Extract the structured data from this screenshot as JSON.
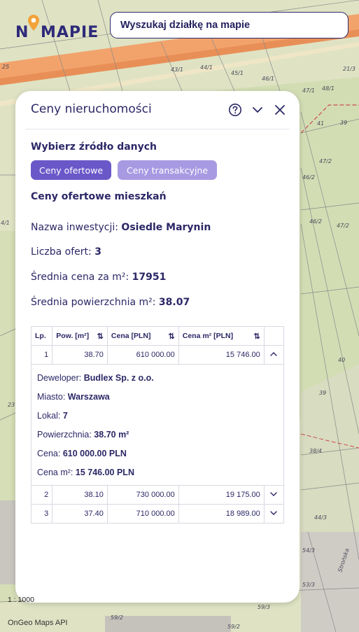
{
  "app": {
    "logo_text_left": "N",
    "logo_text_right": "MAPIE"
  },
  "search": {
    "placeholder": "Wyszukaj działkę na mapie"
  },
  "map": {
    "plot_labels": [
      "25",
      "43/1",
      "44/1",
      "45/1",
      "46/1",
      "21/3",
      "47/1",
      "48/1",
      "41",
      "39",
      "47/2",
      "46/2",
      "47/2",
      "46/2",
      "4/1",
      "40",
      "39",
      "23",
      "38/4",
      "44/3",
      "54/3",
      "53/3",
      "59/3",
      "59/2",
      "59/2"
    ],
    "street_name": "Strońska",
    "scale_text": "1 : 1000",
    "attribution": "OnGeo Maps API"
  },
  "panel": {
    "title": "Ceny nieruchomości",
    "source_heading": "Wybierz źródło danych",
    "tabs": [
      {
        "label": "Ceny ofertowe",
        "active": true
      },
      {
        "label": "Ceny transakcyjne",
        "active": false
      }
    ],
    "subheading": "Ceny ofertowe mieszkań",
    "info": {
      "investment_label": "Nazwa inwestycji:",
      "investment_value": "Osiedle Marynin",
      "offers_label": "Liczba ofert:",
      "offers_value": "3",
      "avg_price_label": "Średnia cena za m²:",
      "avg_price_value": "17951",
      "avg_area_label": "Średnia powierzchnia m²:",
      "avg_area_value": "38.07"
    },
    "table": {
      "headers": [
        "Lp.",
        "Pow. [m²]",
        "Cena [PLN]",
        "Cena m² [PLN]"
      ],
      "rows": [
        {
          "lp": "1",
          "area": "38.70",
          "price": "610 000.00",
          "price_m2": "15 746.00"
        },
        {
          "lp": "2",
          "area": "38.10",
          "price": "730 000.00",
          "price_m2": "19 175.00"
        },
        {
          "lp": "3",
          "area": "37.40",
          "price": "710 000.00",
          "price_m2": "18 989.00"
        }
      ],
      "details": {
        "developer_label": "Deweloper:",
        "developer_value": "Budlex Sp. z o.o.",
        "city_label": "Miasto:",
        "city_value": "Warszawa",
        "unit_label": "Lokal:",
        "unit_value": "7",
        "area_label": "Powierzchnia:",
        "area_value": "38.70 m²",
        "price_label": "Cena:",
        "price_value": "610 000.00 PLN",
        "price_m2_label": "Cena m²:",
        "price_m2_value": "15 746.00 PLN"
      }
    }
  },
  "colors": {
    "brand": "#2e2a7a",
    "accent": "#6a58c9",
    "accent_light": "#a89ae2",
    "map_road": "#f2a36b",
    "map_green": "#d6dfb8"
  }
}
